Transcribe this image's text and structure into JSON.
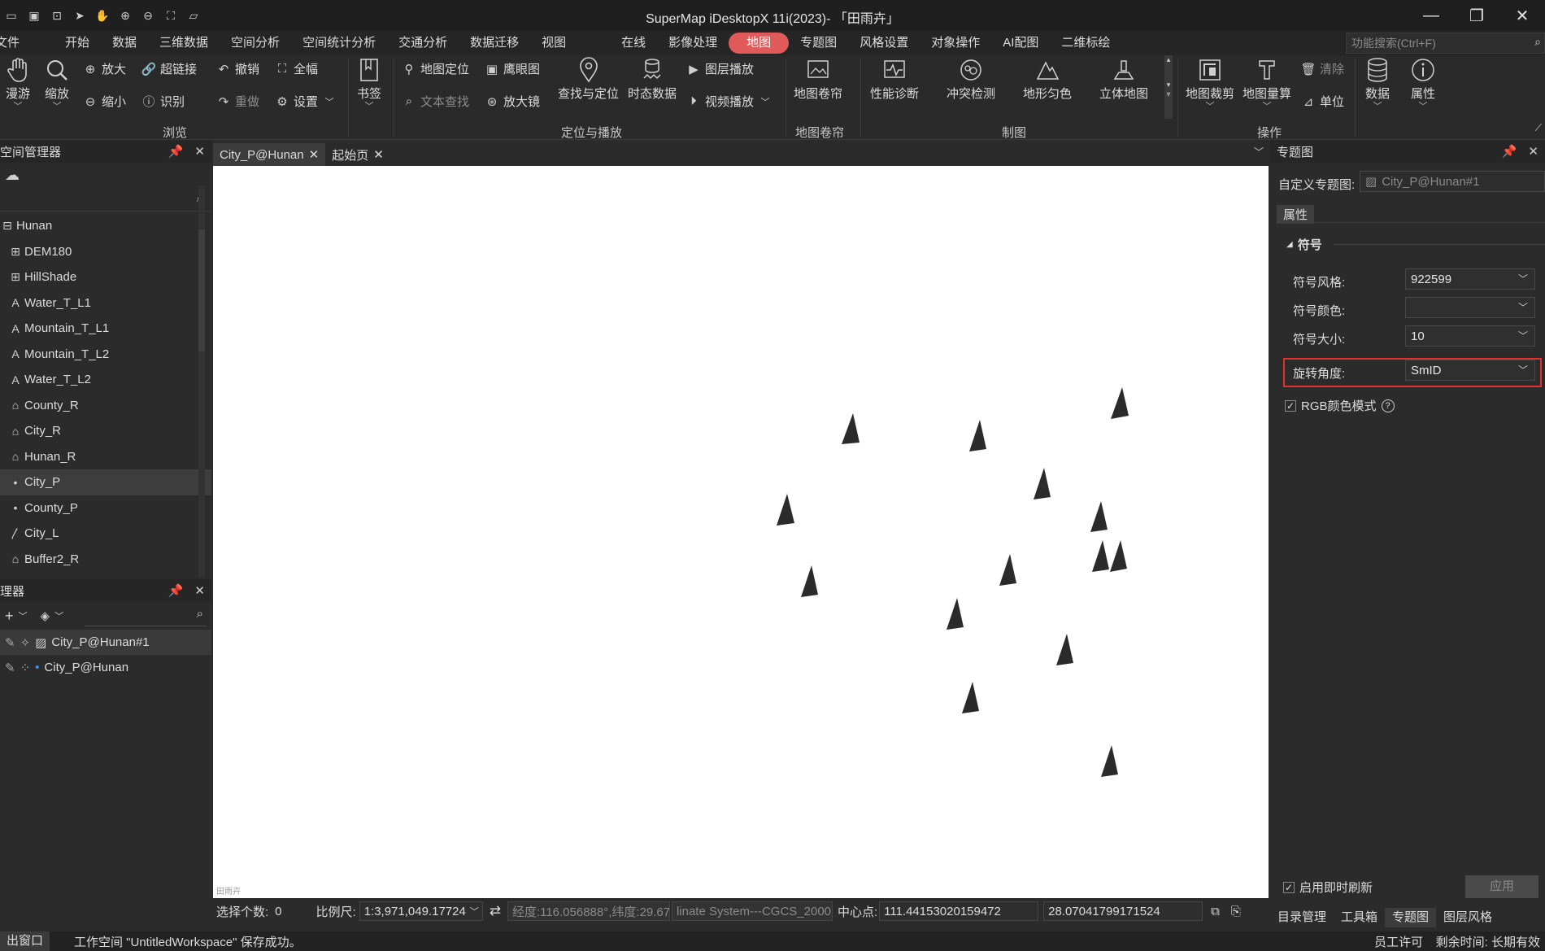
{
  "window": {
    "title": "SuperMap iDesktopX 11i(2023)- 「田雨卉」",
    "quick_access_icons": [
      "save-icon",
      "save-all-icon",
      "layout-icon",
      "select-arrow-icon",
      "pan-hand-icon",
      "zoom-in-icon",
      "zoom-out-icon",
      "full-extent-icon",
      "folder-icon"
    ],
    "controls": [
      "minimize-icon",
      "restore-icon",
      "close-icon"
    ]
  },
  "menu": {
    "items": [
      "文件",
      "开始",
      "数据",
      "三维数据",
      "空间分析",
      "空间统计分析",
      "交通分析",
      "数据迁移",
      "视图",
      "在线",
      "影像处理",
      "地图",
      "专题图",
      "风格设置",
      "对象操作",
      "AI配图",
      "二维标绘"
    ],
    "active": "地图",
    "search_placeholder": "功能搜索(Ctrl+F)"
  },
  "ribbon": {
    "roam": "漫游",
    "zoom": "缩放",
    "zoom_in": "放大",
    "zoom_out": "缩小",
    "hyperlink": "超链接",
    "identify": "识别",
    "undo": "撤销",
    "redo": "重做",
    "full_extent": "全幅",
    "settings": "设置",
    "bookmark": "书签",
    "map_locate": "地图定位",
    "text_search": "文本查找",
    "eagle_eye": "鹰眼图",
    "magnifier": "放大镜",
    "find_locate": "查找与定位",
    "temporal": "时态数据",
    "layer_play": "图层播放",
    "video_play": "视频播放",
    "map_curtain": "地图卷帘",
    "perf_diag": "性能诊断",
    "conflict": "冲突检测",
    "terrain_color": "地形匀色",
    "3d_map": "立体地图",
    "map_clip": "地图裁剪",
    "map_measure": "地图量算",
    "clear": "清除",
    "unit": "单位",
    "data": "数据",
    "properties": "属性",
    "groups": {
      "browse": "浏览",
      "locate_play": "定位与播放",
      "curtain": "地图卷帘",
      "cartography": "制图",
      "operation": "操作"
    }
  },
  "workspace_panel": {
    "title": "工作空间管理器",
    "title_visible": "空间管理器",
    "items": [
      {
        "label": "Hunan",
        "icon": "datasource-icon",
        "child": false
      },
      {
        "label": "DEM180",
        "icon": "grid-icon",
        "child": true
      },
      {
        "label": "HillShade",
        "icon": "grid-icon",
        "child": true
      },
      {
        "label": "Water_T_L1",
        "icon": "text-dataset-icon",
        "child": true
      },
      {
        "label": "Mountain_T_L1",
        "icon": "text-dataset-icon",
        "child": true
      },
      {
        "label": "Mountain_T_L2",
        "icon": "text-dataset-icon",
        "child": true
      },
      {
        "label": "Water_T_L2",
        "icon": "text-dataset-icon",
        "child": true
      },
      {
        "label": "County_R",
        "icon": "region-icon",
        "child": true
      },
      {
        "label": "City_R",
        "icon": "region-icon",
        "child": true
      },
      {
        "label": "Hunan_R",
        "icon": "region-icon",
        "child": true
      },
      {
        "label": "City_P",
        "icon": "point-icon",
        "child": true,
        "selected": true
      },
      {
        "label": "County_P",
        "icon": "point-icon",
        "child": true
      },
      {
        "label": "City_L",
        "icon": "line-icon",
        "child": true
      },
      {
        "label": "Buffer2_R",
        "icon": "region-icon",
        "child": true
      }
    ]
  },
  "layer_panel": {
    "title_visible": "理器",
    "layers": [
      {
        "label": "City_P@Hunan#1",
        "selected": true
      },
      {
        "label": "City_P@Hunan",
        "selected": false
      }
    ]
  },
  "doc_tabs": [
    {
      "label": "City_P@Hunan",
      "active": true
    },
    {
      "label": "起始页",
      "active": false
    }
  ],
  "map": {
    "watermark": "田雨卉",
    "symbol_color": "#2b2b2b",
    "background": "#ffffff"
  },
  "map_status": {
    "selected_count_label": "选择个数:",
    "selected_count": "0",
    "scale_label": "比例尺:",
    "scale_value": "1:3,971,049.17724",
    "coords": "经度:116.056888°,纬度:29.67",
    "coord_system": "linate System---CGCS_2000",
    "center_label": "中心点:",
    "center_x": "111.44153020159472",
    "center_y": "28.07041799171524"
  },
  "thematic_panel": {
    "title": "专题图",
    "custom_label": "自定义专题图:",
    "custom_value": "City_P@Hunan#1",
    "tab_properties": "属性",
    "section_symbol": "符号",
    "symbol_style_label": "符号风格:",
    "symbol_style_value": "922599",
    "symbol_color_label": "符号颜色:",
    "symbol_color_value": "",
    "symbol_size_label": "符号大小:",
    "symbol_size_value": "10",
    "rotation_label": "旋转角度:",
    "rotation_value": "SmID",
    "rgb_mode_label": "RGB颜色模式",
    "rgb_mode_checked": true,
    "realtime_label": "启用即时刷新",
    "realtime_checked": true,
    "apply_label": "应用",
    "bottom_tabs": [
      "目录管理",
      "工具箱",
      "专题图",
      "图层风格"
    ],
    "active_bottom_tab": "专题图",
    "highlight_color": "#e03030"
  },
  "app_status": {
    "left_label": "输出窗口",
    "left_visible": "出窗口",
    "message": "工作空间 \"UntitledWorkspace\" 保存成功。",
    "license": "员工许可",
    "remaining_label": "剩余时间: 长期有效"
  }
}
